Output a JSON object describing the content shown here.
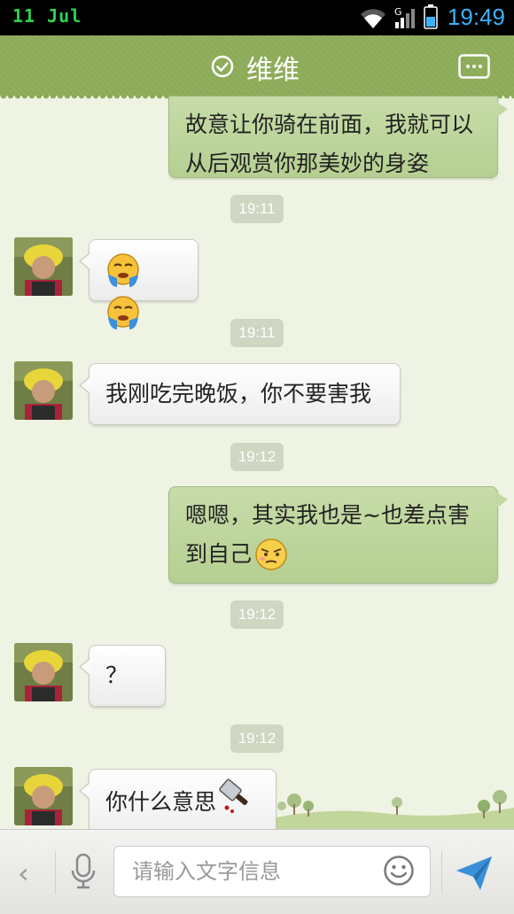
{
  "status_bar": {
    "date": "11  Jul",
    "time": "19:49",
    "network_type": "G"
  },
  "title_bar": {
    "title": "维维"
  },
  "messages": [
    {
      "dir": "out",
      "text": "故意让你骑在前面，我就可以从后观赏你那美妙的身姿"
    },
    {
      "timestamp": "19:11"
    },
    {
      "dir": "in",
      "emoji": [
        "crying-emoji",
        "crying-emoji"
      ]
    },
    {
      "timestamp": "19:11"
    },
    {
      "dir": "in",
      "text": "我刚吃完晚饭，你不要害我"
    },
    {
      "timestamp": "19:12"
    },
    {
      "dir": "out",
      "text": "嗯嗯，其实我也是~也差点害到自己",
      "emoji": "embarrassed-emoji"
    },
    {
      "timestamp": "19:12"
    },
    {
      "dir": "in",
      "text": "？"
    },
    {
      "timestamp": "19:12"
    },
    {
      "dir": "in",
      "text": "你什么意思",
      "emoji": "knife-emoji"
    }
  ],
  "input_bar": {
    "placeholder": "请输入文字信息"
  },
  "icons": [
    "check-icon",
    "more-icon",
    "chevron-left-icon",
    "microphone-icon",
    "smiley-icon",
    "send-icon"
  ],
  "colors": {
    "title_bar": "#8cab58",
    "out_bubble": "#b5cf92",
    "in_bubble": "#ffffff",
    "timestamp_bg": "#cfd6c2",
    "time_text": "#3cb0ff",
    "date_text": "#2fd14d"
  }
}
